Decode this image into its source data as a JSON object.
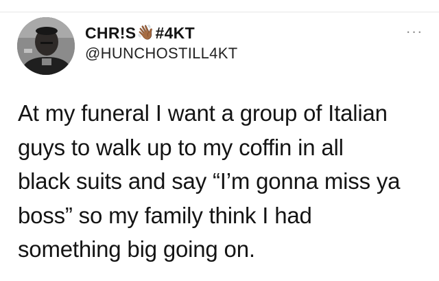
{
  "tweet": {
    "author": {
      "display_name": "CHR!S",
      "emoji": "👋🏾",
      "display_tag": "#4KT",
      "handle": "@HUNCHOSTILL4KT",
      "avatar_icon": "profile-photo"
    },
    "more_label": "···",
    "text_lines": [
      "At my funeral I want a group of Italian",
      "guys to walk up to my coffin in all",
      "black suits and say “I’m gonna miss ya",
      "boss” so my family think I had",
      "something big going on."
    ]
  },
  "colors": {
    "text": "#141414",
    "muted": "#8f8f8f",
    "divider": "#e6e6e6",
    "background": "#ffffff"
  }
}
